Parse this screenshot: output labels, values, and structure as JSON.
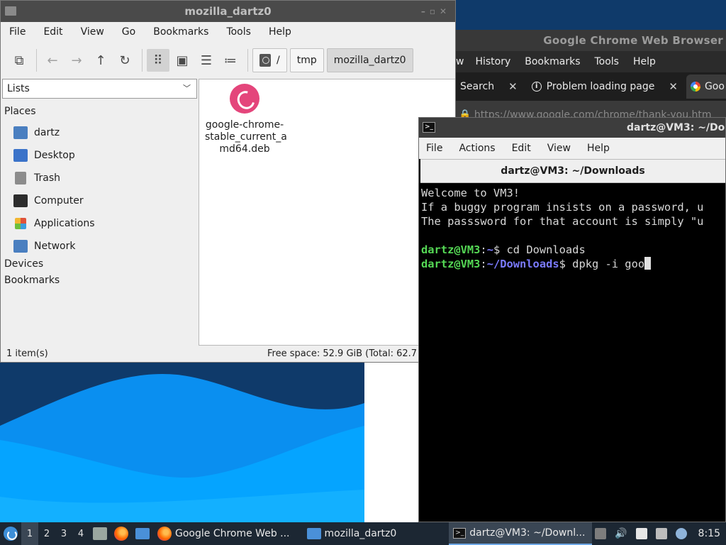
{
  "file_manager": {
    "title": "mozilla_dartz0",
    "menu": [
      "File",
      "Edit",
      "View",
      "Go",
      "Bookmarks",
      "Tools",
      "Help"
    ],
    "path": [
      "/",
      "tmp",
      "mozilla_dartz0"
    ],
    "side_mode": "Lists",
    "sections": {
      "places": "Places",
      "devices": "Devices",
      "bookmarks": "Bookmarks"
    },
    "places": [
      {
        "label": "dartz",
        "icon": "home-folder-icon",
        "color": "#4a7fc0"
      },
      {
        "label": "Desktop",
        "icon": "desktop-folder-icon",
        "color": "#3b73c9"
      },
      {
        "label": "Trash",
        "icon": "trash-icon",
        "color": "#8c8c8c"
      },
      {
        "label": "Computer",
        "icon": "computer-icon",
        "color": "#2d2d2d"
      },
      {
        "label": "Applications",
        "icon": "applications-icon",
        "color": "#e0533a"
      },
      {
        "label": "Network",
        "icon": "network-icon",
        "color": "#4a7fc0"
      }
    ],
    "files": [
      {
        "name_lines": [
          "google-chrome-",
          "stable_current_a",
          "md64.deb"
        ],
        "icon": "debian-package-icon"
      }
    ],
    "status_left": "1 item(s)",
    "status_right": "Free space: 52.9 GiB (Total: 62.7"
  },
  "chrome": {
    "title": "Google Chrome Web Browser",
    "menu": [
      "w",
      "History",
      "Bookmarks",
      "Tools",
      "Help"
    ],
    "tabs": [
      {
        "label": "Search"
      },
      {
        "label": "Problem loading page"
      },
      {
        "label": "Goo"
      }
    ],
    "url": "https://www.google.com/chrome/thank-you.htm"
  },
  "terminal": {
    "title": "dartz@VM3: ~/Do",
    "menu": [
      "File",
      "Actions",
      "Edit",
      "View",
      "Help"
    ],
    "tab_label": "dartz@VM3: ~/Downloads",
    "lines": [
      "Welcome to VM3!",
      "If a buggy program insists on a password, u",
      "The passsword for that account is simply \"u"
    ],
    "prompt1": {
      "user": "dartz@VM3",
      "path": "~",
      "cmd": " cd Downloads"
    },
    "prompt2": {
      "user": "dartz@VM3",
      "path": "~/Downloads",
      "cmd": " dpkg -i goo"
    }
  },
  "taskbar": {
    "workspaces": [
      "1",
      "2",
      "3",
      "4"
    ],
    "active_workspace": "1",
    "tasks": [
      {
        "label": "Google Chrome Web ..."
      },
      {
        "label": "mozilla_dartz0"
      },
      {
        "label": "dartz@VM3: ~/Downl..."
      }
    ],
    "clock": "8:15"
  }
}
